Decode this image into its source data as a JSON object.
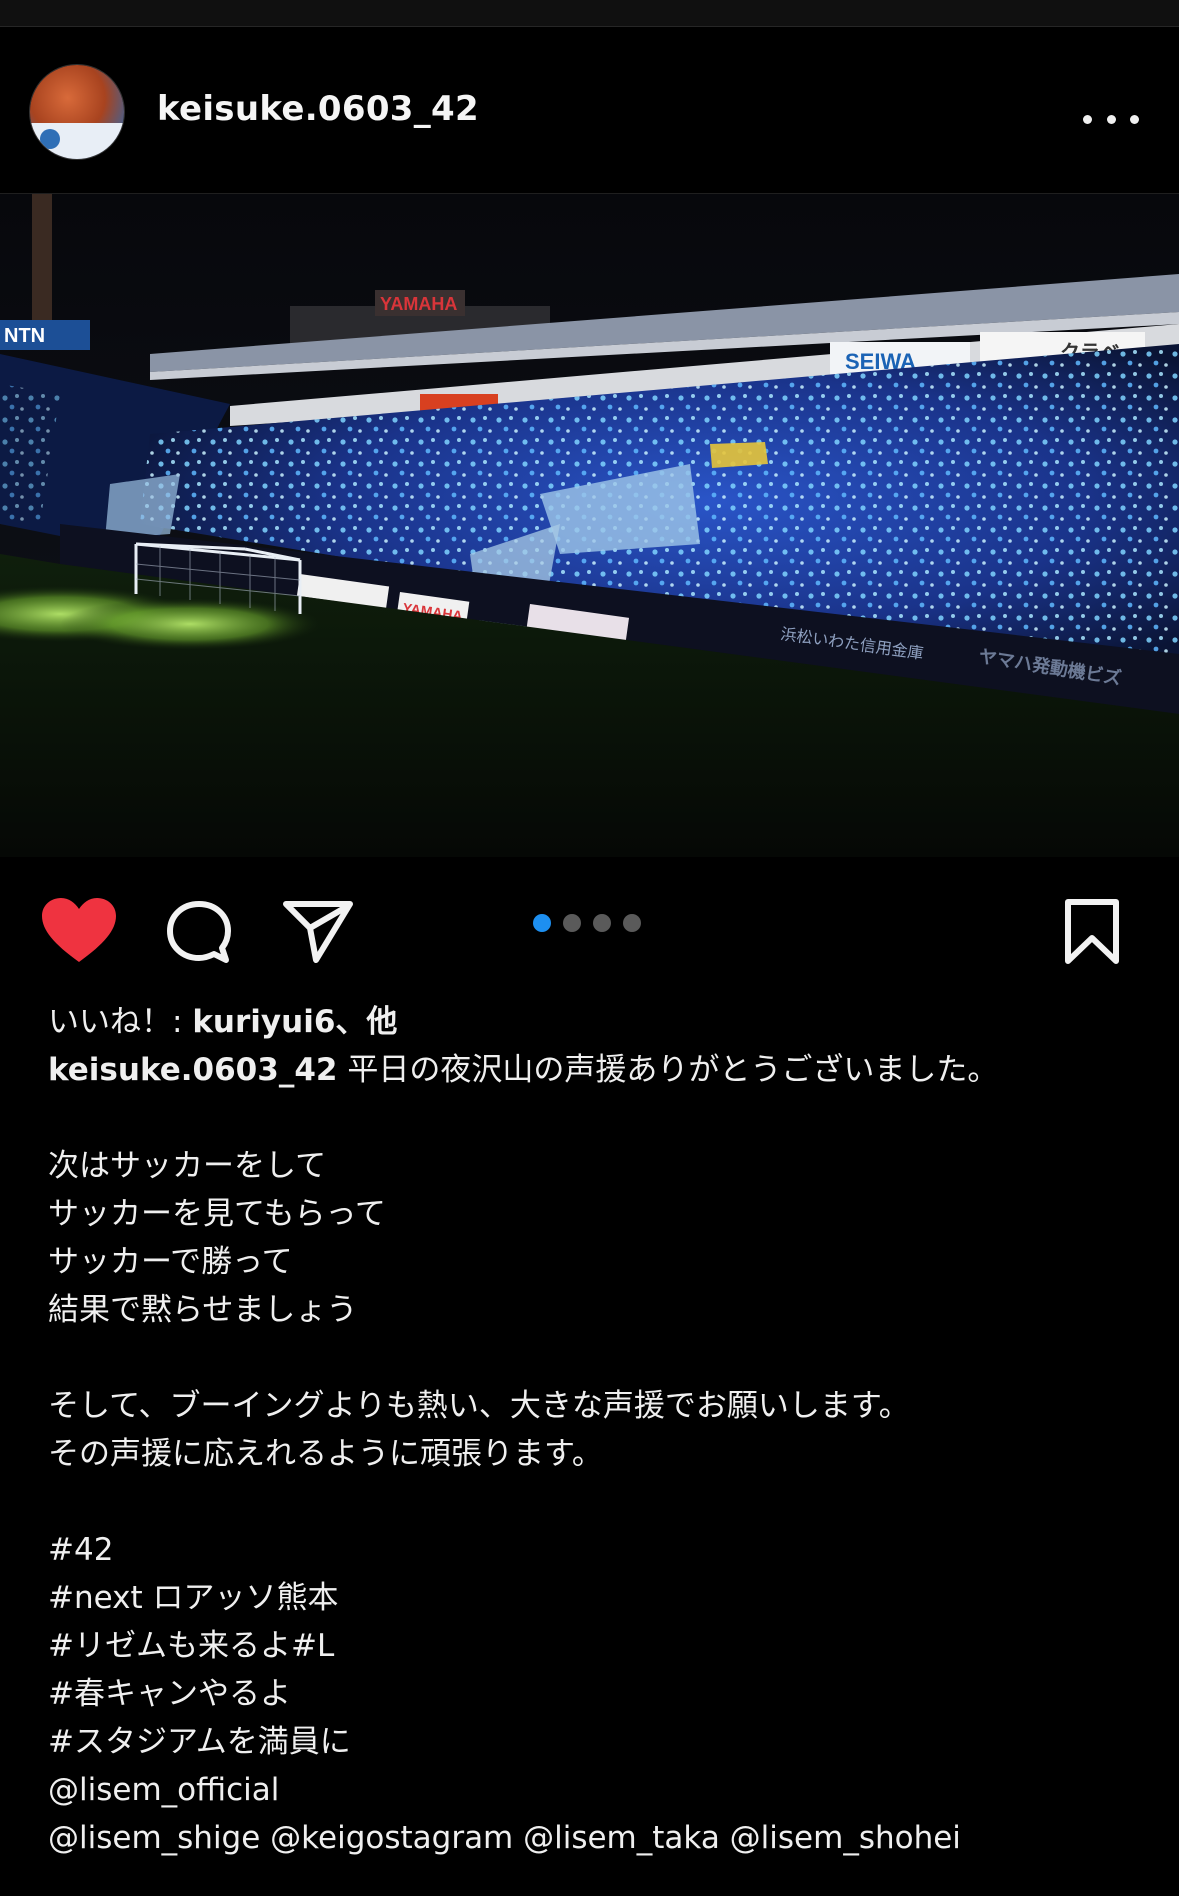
{
  "post": {
    "username": "keisuke.0603_42",
    "more_icon": "more-horizontal-icon",
    "carousel": {
      "total": 4,
      "active": 1
    },
    "likes": {
      "prefix": "いいね！: ",
      "users": "kuriyui6、他"
    },
    "caption": {
      "username": "keisuke.0603_42",
      "first_line": " 平日の夜沢山の声援ありがとうございました。",
      "lines": [
        "",
        "次はサッカーをして",
        "サッカーを見てもらって",
        "サッカーで勝って",
        "結果で黙らせましょう",
        "",
        "そして、ブーイングよりも熱い、大きな声援でお願いします。",
        "その声援に応えれるように頑張ります。",
        "",
        "#42",
        "#next ロアッソ熊本",
        "#リゼムも来るよ#L",
        "#春キャンやるよ",
        "#スタジアムを満員に",
        "@lisem_official",
        "@lisem_shige @keigostagram @lisem_taka @lisem_shohei"
      ]
    },
    "photo_signage": {
      "yamaha_roof": "YAMAHA",
      "ntn": "NTN",
      "seiwa": "SEIWA",
      "kurabe": "クラベ",
      "bank": "浜松いわた信用金庫",
      "yamaha_board": "YAMAHA",
      "yamaha_bottom": "ヤマハ発動機ビズ"
    }
  },
  "colors": {
    "background": "#000000",
    "text": "#f5f5f5",
    "heart": "#ef3340",
    "carousel_active": "#1d8ff0",
    "carousel_inactive": "#5a5a5a"
  }
}
